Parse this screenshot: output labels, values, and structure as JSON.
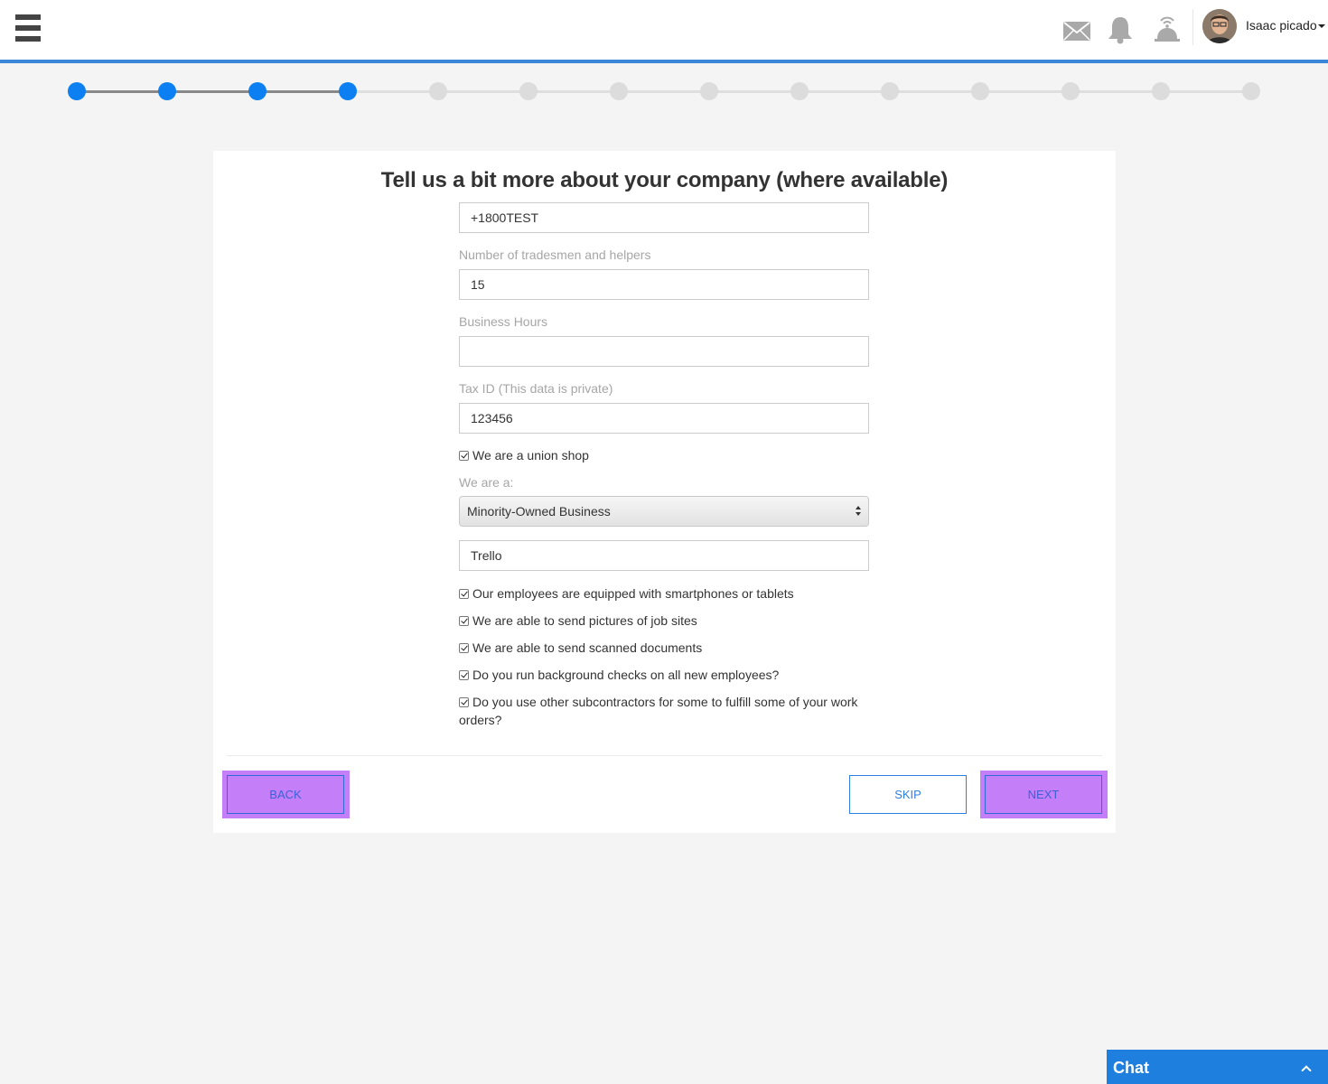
{
  "header": {
    "menu_icon": "hamburger-menu-icon",
    "icons": [
      "mail-icon",
      "bell-icon",
      "bellhop-icon"
    ],
    "user_name": "Isaac picado",
    "accent_color": "#3b86d8"
  },
  "stepper": {
    "total_steps": 14,
    "completed_steps": 4,
    "done_color": "#0c7ff2",
    "todo_color": "#dcdcdc"
  },
  "form": {
    "title": "Tell us a bit more about your company (where available)",
    "phone_value": "+1800TEST",
    "tradesmen_label": "Number of tradesmen and helpers",
    "tradesmen_value": "15",
    "business_hours_label": "Business Hours",
    "business_hours_value": "",
    "tax_id_label": "Tax ID (This data is private)",
    "tax_id_value": "123456",
    "union_shop_label": "We are a union shop",
    "union_shop_checked": true,
    "we_are_a_label": "We are a:",
    "business_type_selected": "Minority-Owned Business",
    "software_value": "Trello",
    "checks": [
      {
        "label": "Our employees are equipped with smartphones or tablets",
        "checked": true
      },
      {
        "label": "We are able to send pictures of job sites",
        "checked": true
      },
      {
        "label": "We are able to send scanned documents",
        "checked": true
      },
      {
        "label": "Do you run background checks on all new employees?",
        "checked": true
      },
      {
        "label": "Do you use other subcontractors for some to fulfill some of your work orders?",
        "checked": true
      }
    ]
  },
  "buttons": {
    "back": "BACK",
    "skip": "SKIP",
    "next": "NEXT",
    "highlight_color": "#c47ef7"
  },
  "chat": {
    "label": "Chat",
    "color": "#1e7fdf"
  }
}
